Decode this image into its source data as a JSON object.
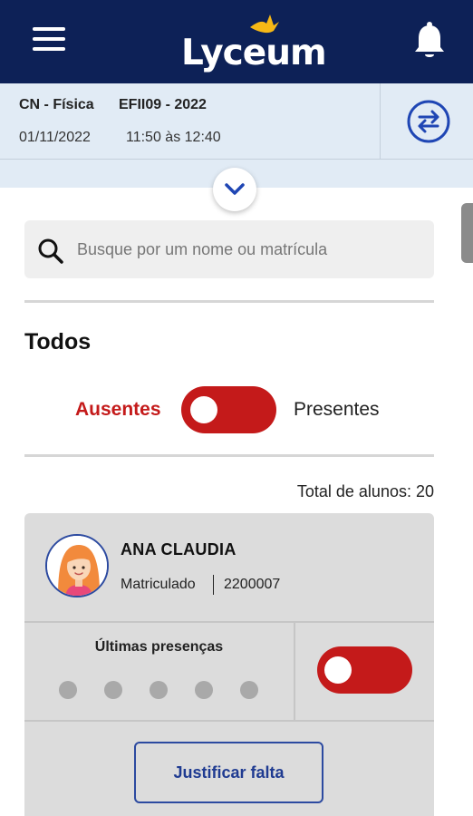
{
  "header": {
    "logo_text": "Lyceum",
    "menu_icon": "hamburger-menu-icon",
    "notification_icon": "bell-icon",
    "brand_color": "#0d2157"
  },
  "class_info": {
    "subject": "CN - Física",
    "class_code": "EFII09 - 2022",
    "date": "01/11/2022",
    "time": "11:50 às 12:40",
    "swap_icon": "swap-arrows-icon",
    "expand_icon": "chevron-down-icon"
  },
  "search": {
    "placeholder": "Busque por um nome ou matrícula",
    "value": ""
  },
  "filter": {
    "title": "Todos",
    "absent_label": "Ausentes",
    "present_label": "Presentes",
    "toggle_color": "#c41a1a"
  },
  "summary": {
    "total_text": "Total de alunos: 20"
  },
  "students": [
    {
      "name": "ANA CLAUDIA",
      "status": "Matriculado",
      "id": "2200007",
      "last_presences_title": "Últimas presenças",
      "last_presences_count": 5,
      "justify_label": "Justificar falta"
    }
  ]
}
